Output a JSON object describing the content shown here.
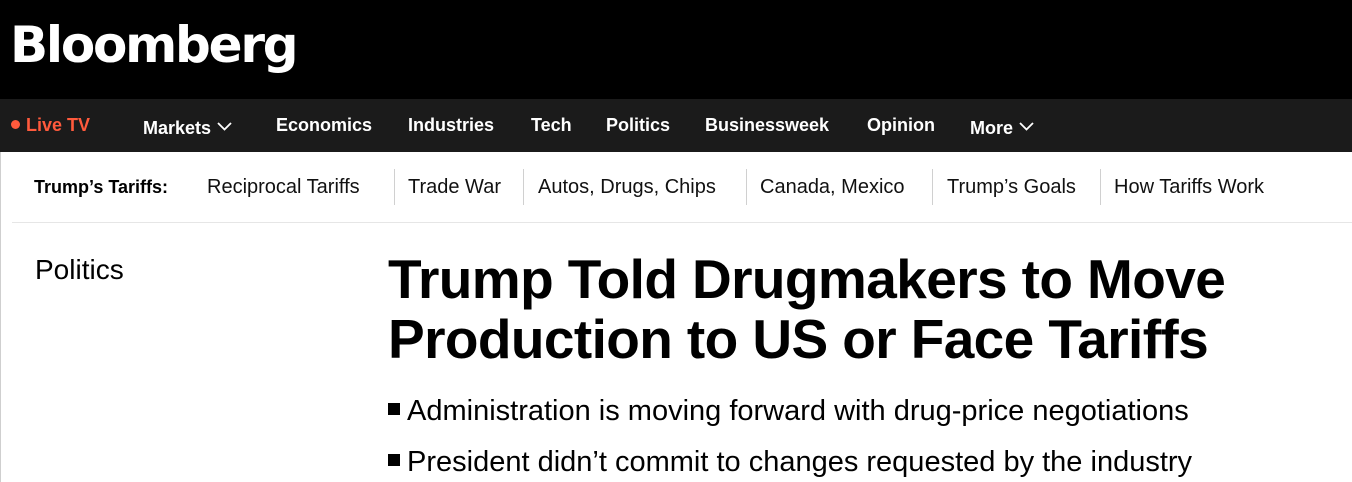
{
  "brand": {
    "logo_text": "Bloomberg"
  },
  "nav": {
    "live_label": "Live TV",
    "items": [
      {
        "label": "Markets",
        "has_dropdown": true
      },
      {
        "label": "Economics"
      },
      {
        "label": "Industries"
      },
      {
        "label": "Tech"
      },
      {
        "label": "Politics"
      },
      {
        "label": "Businessweek"
      },
      {
        "label": "Opinion"
      },
      {
        "label": "More",
        "has_dropdown": true
      }
    ],
    "icons": {
      "live": "live-dot-icon",
      "dropdown": "chevron-down-icon"
    }
  },
  "tariff_bar": {
    "label": "Trump’s Tariffs:",
    "links": [
      "Reciprocal Tariffs",
      "Trade War",
      "Autos, Drugs, Chips",
      "Canada, Mexico",
      "Trump’s Goals",
      "How Tariffs Work"
    ]
  },
  "article": {
    "section": "Politics",
    "headline": "Trump Told Drugmakers to Move Production to US or Face Tariffs",
    "bullets": [
      "Administration is moving forward with drug-price negotiations",
      "President didn’t commit to changes requested by the industry"
    ]
  },
  "colors": {
    "masthead_bg": "#000000",
    "nav_bg": "#1b1b1b",
    "live_accent": "#ff5a3c"
  }
}
